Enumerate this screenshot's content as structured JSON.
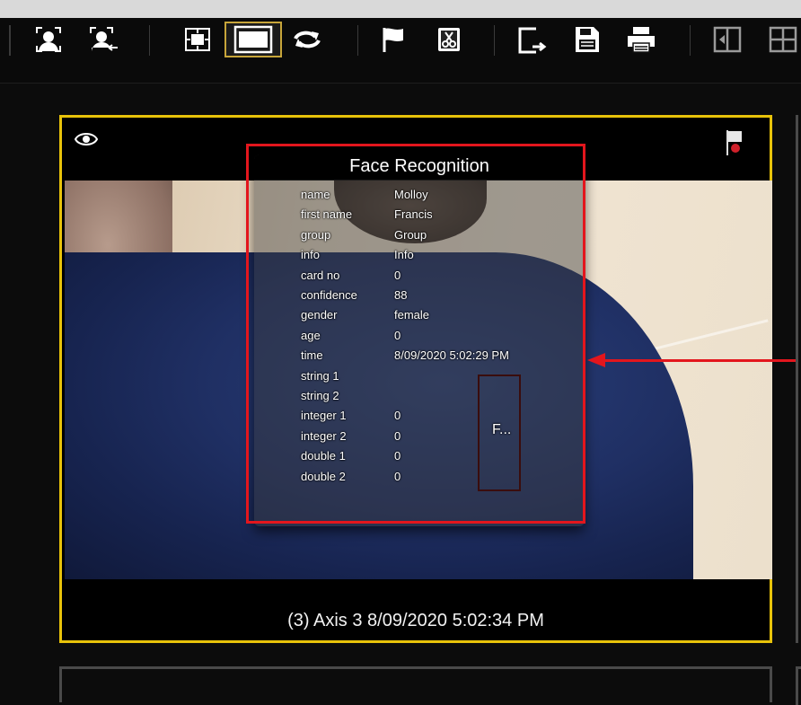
{
  "toolbar": {
    "buttons": [
      {
        "name": "face-enroll-icon"
      },
      {
        "name": "face-remove-icon"
      },
      {
        "name": "fit-view-icon"
      },
      {
        "name": "fill-view-icon",
        "active": true
      },
      {
        "name": "refresh-icon"
      },
      {
        "name": "flag-icon"
      },
      {
        "name": "cut-icon"
      },
      {
        "name": "export-icon"
      },
      {
        "name": "save-icon"
      },
      {
        "name": "print-icon"
      },
      {
        "name": "layout-split-icon"
      },
      {
        "name": "layout-grid-icon"
      }
    ],
    "active_color": "#c7a53a"
  },
  "tile": {
    "caption": "(3) Axis 3  8/09/2020 5:02:34 PM",
    "border_color": "#e8c30a"
  },
  "face_recognition": {
    "title": "Face Recognition",
    "fields": [
      {
        "key": "name",
        "value": "Molloy"
      },
      {
        "key": "first name",
        "value": "Francis"
      },
      {
        "key": "group",
        "value": "Group"
      },
      {
        "key": "info",
        "value": "Info"
      },
      {
        "key": "card no",
        "value": "0"
      },
      {
        "key": "confidence",
        "value": "88"
      },
      {
        "key": "gender",
        "value": "female"
      },
      {
        "key": "age",
        "value": "0"
      },
      {
        "key": "time",
        "value": "8/09/2020 5:02:29 PM"
      },
      {
        "key": "string 1",
        "value": ""
      },
      {
        "key": "string 2",
        "value": ""
      },
      {
        "key": "integer 1",
        "value": "0"
      },
      {
        "key": "integer 2",
        "value": "0"
      },
      {
        "key": "double 1",
        "value": "0"
      },
      {
        "key": "double 2",
        "value": "0"
      }
    ],
    "thumbnail_text": "F..."
  },
  "annotation": {
    "color": "#e3161d"
  }
}
